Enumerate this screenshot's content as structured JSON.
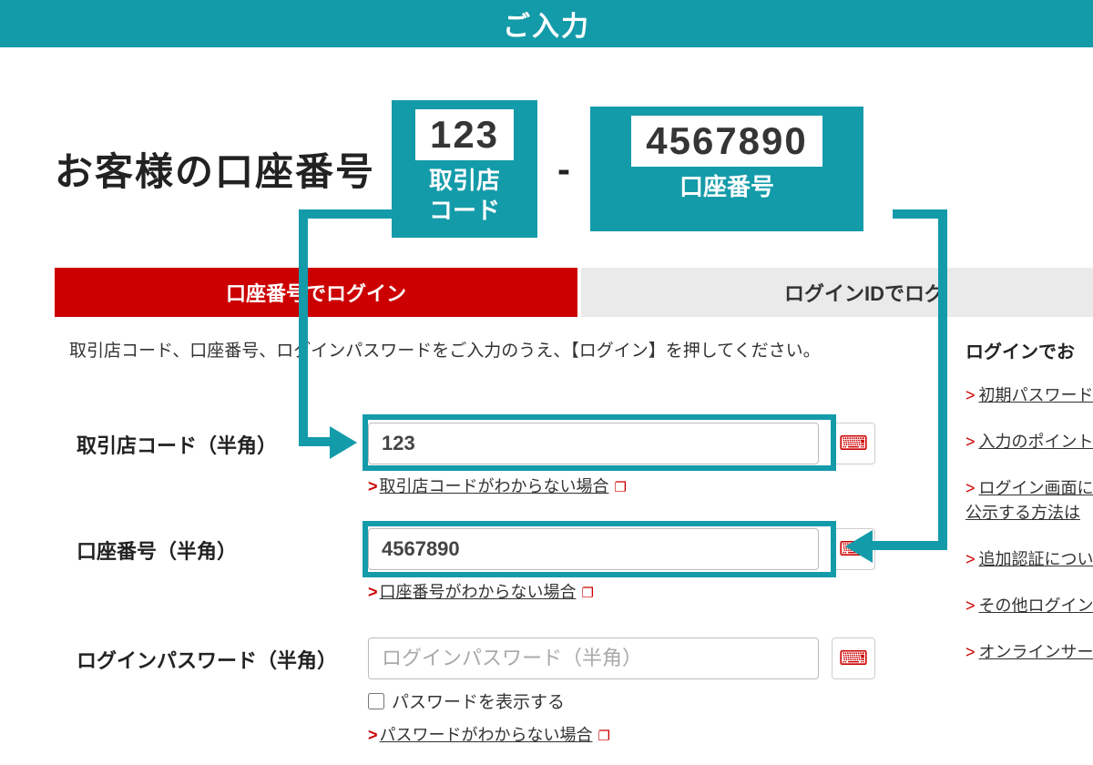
{
  "colors": {
    "accent": "#149baa",
    "red": "#cc0000"
  },
  "topbar": {
    "title": "ご入力"
  },
  "heading": {
    "label": "お客様の口座番号",
    "branch": {
      "value": "123",
      "label": "取引店\nコード"
    },
    "hyphen": "-",
    "account": {
      "value": "4567890",
      "label": "口座番号"
    }
  },
  "tabs": {
    "active": "口座番号でログイン",
    "inactive": "ログインIDでログ"
  },
  "instruction": "取引店コード、口座番号、ログインパスワードをご入力のうえ、【ログイン】を押してください。",
  "fields": {
    "branch": {
      "label": "取引店コード（半角）",
      "value": "123",
      "help": "取引店コードがわからない場合"
    },
    "account": {
      "label": "口座番号（半角）",
      "value": "4567890",
      "help": "口座番号がわからない場合"
    },
    "password": {
      "label": "ログインパスワード（半角）",
      "placeholder": "ログインパスワード（半角）",
      "show_label": "パスワードを表示する",
      "help": "パスワードがわからない場合"
    }
  },
  "sidebar": {
    "title": "ログインでお",
    "links": [
      "初期パスワード",
      "入力のポイント",
      "ログイン画面に便\n公示する方法は",
      "追加認証について",
      "その他ログインに",
      "オンラインサー"
    ]
  },
  "icons": {
    "keyboard": "⌨",
    "external": "❐"
  }
}
